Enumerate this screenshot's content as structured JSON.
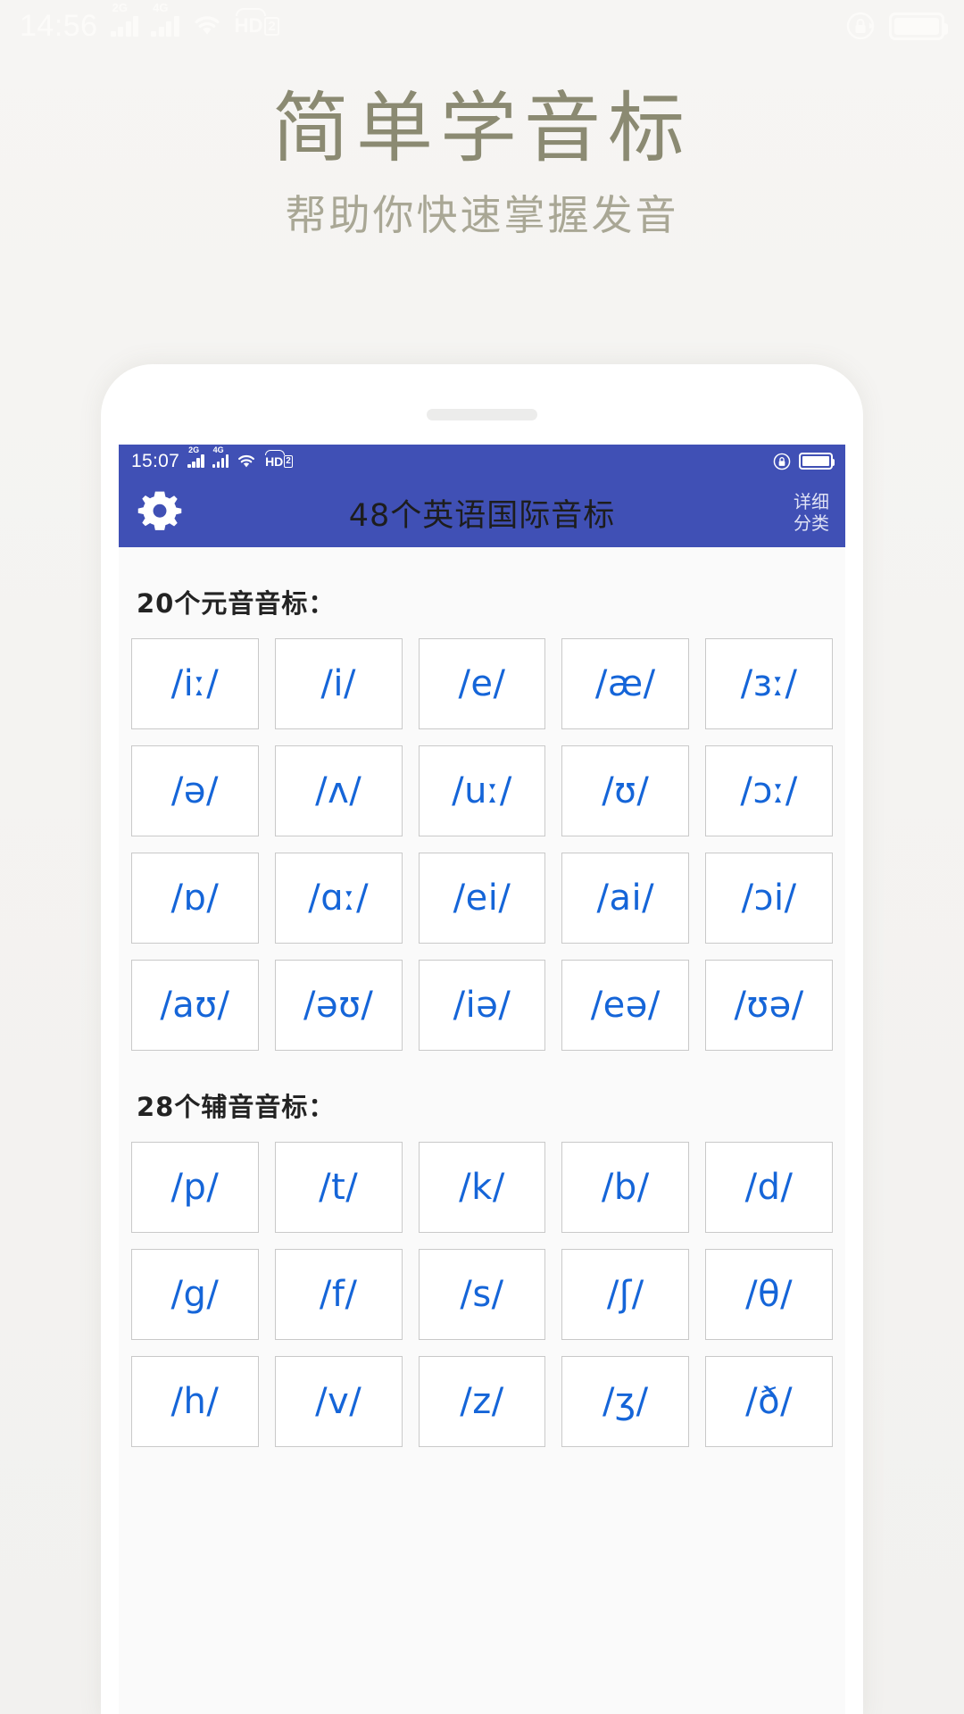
{
  "outer_status": {
    "clock": "14:56",
    "signal1_label": "2G",
    "signal2_label": "4G",
    "hd_text": "HD",
    "hd_badge": "2",
    "wifi_icon": "wifi-icon",
    "rotation_lock_icon": "rotation-lock-icon",
    "battery_icon": "battery-icon"
  },
  "hero": {
    "title": "简单学音标",
    "subtitle": "帮助你快速掌握发音",
    "title_color": "#8b8a72",
    "subtitle_color": "#a9a795"
  },
  "phone": {
    "speaker_label": "speaker-grille"
  },
  "app": {
    "accent_color": "#4050b5",
    "symbol_color": "#1565d8",
    "inner_status": {
      "clock": "15:07",
      "signal1_label": "2G",
      "signal2_label": "4G",
      "hd_text": "HD",
      "hd_badge": "2",
      "wifi_icon": "wifi-icon",
      "rotation_lock_icon": "rotation-lock-icon",
      "battery_icon": "battery-icon"
    },
    "toolbar": {
      "settings_icon": "gear-icon",
      "title": "48个英语国际音标",
      "action_line1": "详细",
      "action_line2": "分类"
    },
    "sections": [
      {
        "heading": "20个元音音标：",
        "symbols": [
          "/iː/",
          "/i/",
          "/e/",
          "/æ/",
          "/ɜː/",
          "/ə/",
          "/ʌ/",
          "/uː/",
          "/ʊ/",
          "/ɔː/",
          "/ɒ/",
          "/ɑː/",
          "/ei/",
          "/ai/",
          "/ɔi/",
          "/aʊ/",
          "/əʊ/",
          "/iə/",
          "/eə/",
          "/ʊə/"
        ]
      },
      {
        "heading": "28个辅音音标：",
        "symbols": [
          "/p/",
          "/t/",
          "/k/",
          "/b/",
          "/d/",
          "/g/",
          "/f/",
          "/s/",
          "/ʃ/",
          "/θ/",
          "/h/",
          "/v/",
          "/z/",
          "/ʒ/",
          "/ð/"
        ]
      }
    ]
  }
}
